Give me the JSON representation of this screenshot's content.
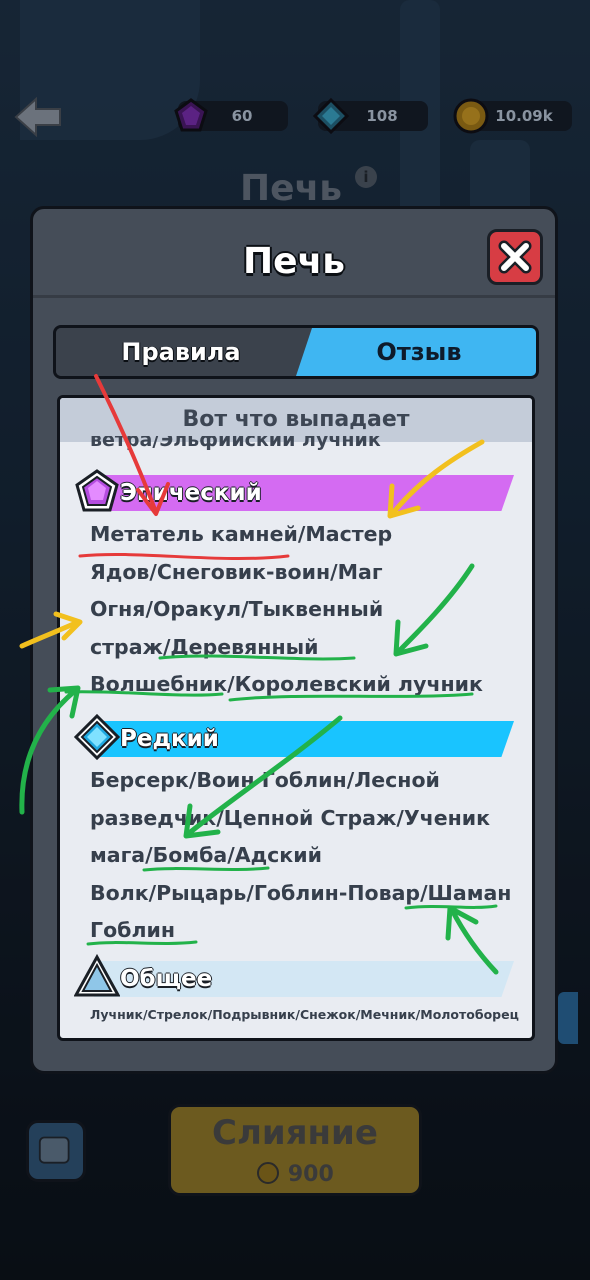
{
  "resources": [
    {
      "icon": "purple-gem-icon",
      "value": "60",
      "color": "#8a2fd1"
    },
    {
      "icon": "blue-gem-icon",
      "value": "108",
      "color": "#2fa3d1"
    },
    {
      "icon": "gold-coin-icon",
      "value": "10.09k",
      "color": "#e2a31a"
    }
  ],
  "background": {
    "title": "Печь"
  },
  "modal": {
    "title": "Печь",
    "tabs": {
      "rules": "Правила",
      "review": "Отзыв"
    },
    "header": "Вот что выпадает",
    "cut_line": "ветра/Эльфийский лучник",
    "categories": [
      {
        "name": "Эпический",
        "color": "#d46bf2",
        "icon": "pentagon-gem-icon",
        "lines": [
          "Метатель камней/Мастер",
          "Ядов/Снеговик-воин/Маг",
          "Огня/Оракул/Тыквенный",
          "страж/Деревянный",
          "Волшебник/Королевский лучник"
        ]
      },
      {
        "name": "Редкий",
        "color": "#19c4ff",
        "icon": "diamond-gem-icon",
        "lines": [
          "Берсерк/Воин Гоблин/Лесной",
          "разведчик/Цепной Страж/Ученик",
          "мага/Бомба/Адский",
          "Волк/Рыцарь/Гоблин-Повар/Шаман",
          "Гоблин"
        ]
      },
      {
        "name": "Общее",
        "color": "#d3e7f4",
        "icon": "triangle-gem-icon",
        "lines": [
          "Лучник/Стрелок/Подрывник/Снежок/Мечник/Молотоборец"
        ]
      }
    ]
  },
  "merge": {
    "label": "Слияние",
    "cost": "900"
  },
  "annotation_colors": {
    "red": "#e63a3a",
    "yellow": "#f2c01e",
    "green": "#22b24a"
  }
}
